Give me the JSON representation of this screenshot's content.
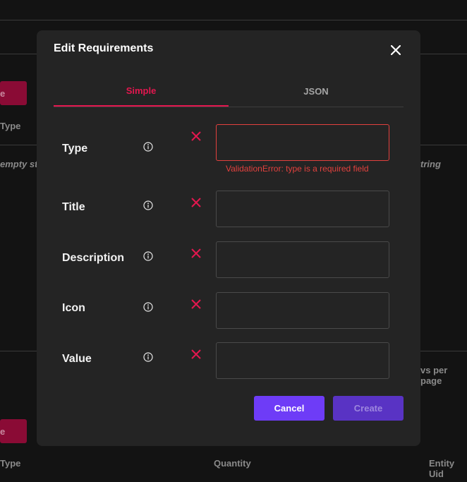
{
  "background": {
    "button_top_label": "e",
    "button_bottom_label": "e",
    "col_type_top": "Type",
    "empty_string_left": "empty str",
    "empty_string_right": "tring",
    "rows_per_page": "vs per page",
    "col_type_bottom": "Type",
    "col_quantity": "Quantity",
    "col_entity_uid": "Entity Uid"
  },
  "dialog": {
    "title": "Edit Requirements",
    "close_icon": "close-icon",
    "tabs": [
      {
        "label": "Simple",
        "active": true
      },
      {
        "label": "JSON",
        "active": false
      }
    ],
    "fields": [
      {
        "label": "Type",
        "value": "",
        "error": "ValidationError: type is a required field"
      },
      {
        "label": "Title",
        "value": ""
      },
      {
        "label": "Description",
        "value": ""
      },
      {
        "label": "Icon",
        "value": ""
      },
      {
        "label": "Value",
        "value": ""
      }
    ],
    "cancel_label": "Cancel",
    "create_label": "Create"
  },
  "colors": {
    "accent": "#e3174f",
    "primary_button": "#6e3cf7",
    "error": "#e2413e",
    "dialog_bg": "#242424"
  }
}
